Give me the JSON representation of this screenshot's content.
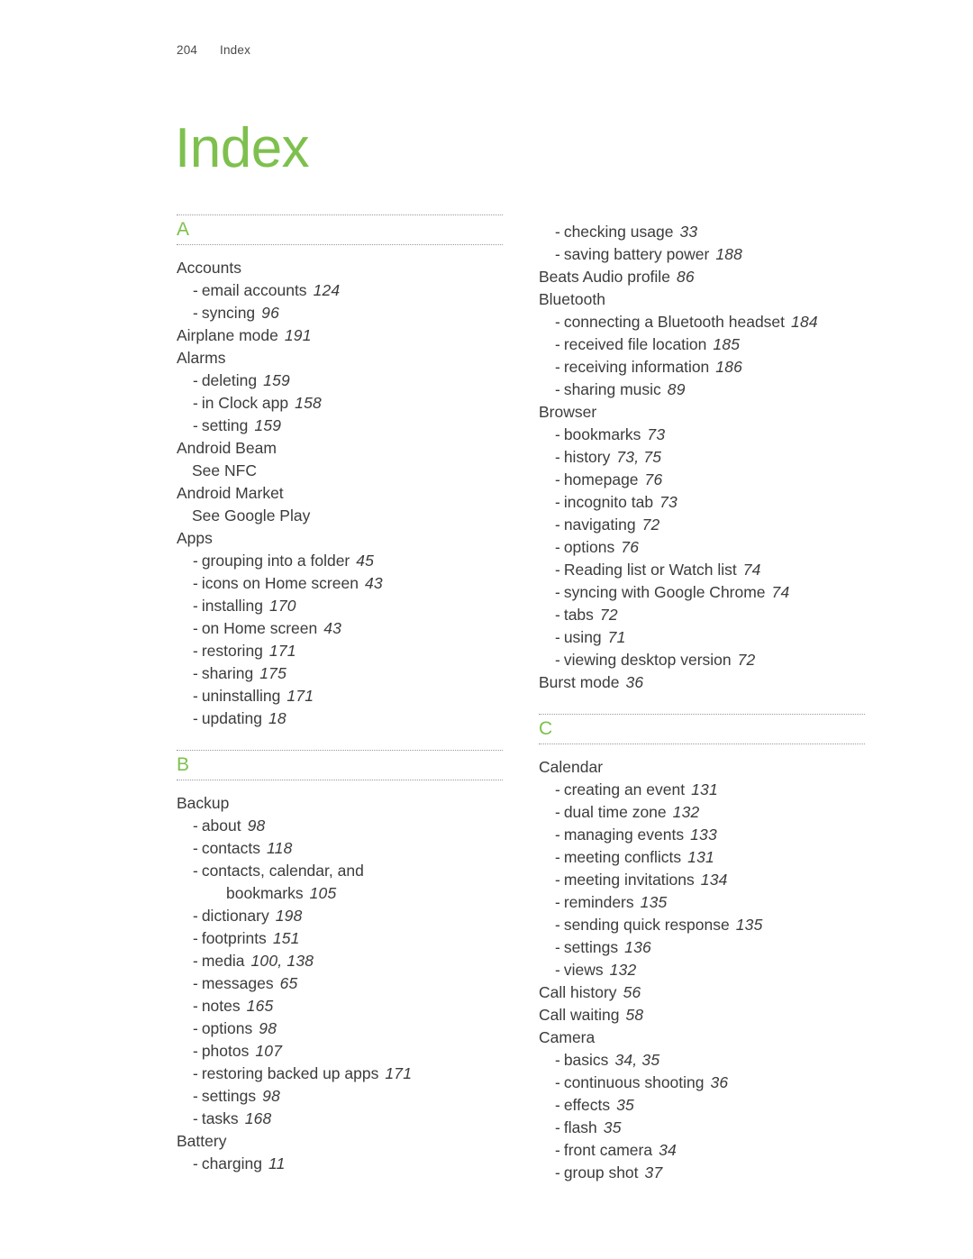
{
  "header": {
    "folio": "204",
    "section": "Index"
  },
  "title": "Index",
  "colors": {
    "accent_green": "#7ec04e",
    "body_text": "#3c3c3c",
    "rule": "#9a9a9a"
  },
  "columns": [
    {
      "name": "left-column",
      "groups": [
        {
          "letter": "A",
          "entries": [
            {
              "type": "main",
              "label": "Accounts",
              "page": ""
            },
            {
              "type": "sub",
              "label": "email accounts",
              "page": "124"
            },
            {
              "type": "sub",
              "label": "syncing",
              "page": "96"
            },
            {
              "type": "main",
              "label": "Airplane mode",
              "page": "191"
            },
            {
              "type": "main",
              "label": "Alarms",
              "page": ""
            },
            {
              "type": "sub",
              "label": "deleting",
              "page": "159"
            },
            {
              "type": "sub",
              "label": "in Clock app",
              "page": "158"
            },
            {
              "type": "sub",
              "label": "setting",
              "page": "159"
            },
            {
              "type": "main",
              "label": "Android Beam",
              "page": ""
            },
            {
              "type": "see",
              "label": "See NFC",
              "page": ""
            },
            {
              "type": "main",
              "label": "Android Market",
              "page": ""
            },
            {
              "type": "see",
              "label": "See Google Play",
              "page": ""
            },
            {
              "type": "main",
              "label": "Apps",
              "page": ""
            },
            {
              "type": "sub",
              "label": "grouping into a folder",
              "page": "45"
            },
            {
              "type": "sub",
              "label": "icons on Home screen",
              "page": "43"
            },
            {
              "type": "sub",
              "label": "installing",
              "page": "170"
            },
            {
              "type": "sub",
              "label": "on Home screen",
              "page": "43"
            },
            {
              "type": "sub",
              "label": "restoring",
              "page": "171"
            },
            {
              "type": "sub",
              "label": "sharing",
              "page": "175"
            },
            {
              "type": "sub",
              "label": "uninstalling",
              "page": "171"
            },
            {
              "type": "sub",
              "label": "updating",
              "page": "18"
            }
          ]
        },
        {
          "letter": "B",
          "entries": [
            {
              "type": "main",
              "label": "Backup",
              "page": ""
            },
            {
              "type": "sub",
              "label": "about",
              "page": "98"
            },
            {
              "type": "sub",
              "label": "contacts",
              "page": "118"
            },
            {
              "type": "sub",
              "label": "contacts, calendar, and",
              "page": ""
            },
            {
              "type": "cont",
              "label": "bookmarks",
              "page": "105"
            },
            {
              "type": "sub",
              "label": "dictionary",
              "page": "198"
            },
            {
              "type": "sub",
              "label": "footprints",
              "page": "151"
            },
            {
              "type": "sub",
              "label": "media",
              "page": "100, 138"
            },
            {
              "type": "sub",
              "label": "messages",
              "page": "65"
            },
            {
              "type": "sub",
              "label": "notes",
              "page": "165"
            },
            {
              "type": "sub",
              "label": "options",
              "page": "98"
            },
            {
              "type": "sub",
              "label": "photos",
              "page": "107"
            },
            {
              "type": "sub",
              "label": "restoring backed up apps",
              "page": "171"
            },
            {
              "type": "sub",
              "label": "settings",
              "page": "98"
            },
            {
              "type": "sub",
              "label": "tasks",
              "page": "168"
            },
            {
              "type": "main",
              "label": "Battery",
              "page": ""
            },
            {
              "type": "sub",
              "label": "charging",
              "page": "11"
            }
          ]
        }
      ]
    },
    {
      "name": "right-column",
      "groups": [
        {
          "letter": "",
          "entries": [
            {
              "type": "sub",
              "label": "checking usage",
              "page": "33"
            },
            {
              "type": "sub",
              "label": "saving battery power",
              "page": "188"
            },
            {
              "type": "main",
              "label": "Beats Audio profile",
              "page": "86"
            },
            {
              "type": "main",
              "label": "Bluetooth",
              "page": ""
            },
            {
              "type": "sub",
              "label": "connecting a Bluetooth headset",
              "page": "184"
            },
            {
              "type": "sub",
              "label": "received file location",
              "page": "185"
            },
            {
              "type": "sub",
              "label": "receiving information",
              "page": "186"
            },
            {
              "type": "sub",
              "label": "sharing music",
              "page": "89"
            },
            {
              "type": "main",
              "label": "Browser",
              "page": ""
            },
            {
              "type": "sub",
              "label": "bookmarks",
              "page": "73"
            },
            {
              "type": "sub",
              "label": "history",
              "page": "73, 75"
            },
            {
              "type": "sub",
              "label": "homepage",
              "page": "76"
            },
            {
              "type": "sub",
              "label": "incognito tab",
              "page": "73"
            },
            {
              "type": "sub",
              "label": "navigating",
              "page": "72"
            },
            {
              "type": "sub",
              "label": "options",
              "page": "76"
            },
            {
              "type": "sub",
              "label": "Reading list or Watch list",
              "page": "74"
            },
            {
              "type": "sub",
              "label": "syncing with Google Chrome",
              "page": "74"
            },
            {
              "type": "sub",
              "label": "tabs",
              "page": "72"
            },
            {
              "type": "sub",
              "label": "using",
              "page": "71"
            },
            {
              "type": "sub",
              "label": "viewing desktop version",
              "page": "72"
            },
            {
              "type": "main",
              "label": "Burst mode",
              "page": "36"
            }
          ]
        },
        {
          "letter": "C",
          "entries": [
            {
              "type": "main",
              "label": "Calendar",
              "page": ""
            },
            {
              "type": "sub",
              "label": "creating an event",
              "page": "131"
            },
            {
              "type": "sub",
              "label": "dual time zone",
              "page": "132"
            },
            {
              "type": "sub",
              "label": "managing events",
              "page": "133"
            },
            {
              "type": "sub",
              "label": "meeting conflicts",
              "page": "131"
            },
            {
              "type": "sub",
              "label": "meeting invitations",
              "page": "134"
            },
            {
              "type": "sub",
              "label": "reminders",
              "page": "135"
            },
            {
              "type": "sub",
              "label": "sending quick response",
              "page": "135"
            },
            {
              "type": "sub",
              "label": "settings",
              "page": "136"
            },
            {
              "type": "sub",
              "label": "views",
              "page": "132"
            },
            {
              "type": "main",
              "label": "Call history",
              "page": "56"
            },
            {
              "type": "main",
              "label": "Call waiting",
              "page": "58"
            },
            {
              "type": "main",
              "label": "Camera",
              "page": ""
            },
            {
              "type": "sub",
              "label": "basics",
              "page": "34, 35"
            },
            {
              "type": "sub",
              "label": "continuous shooting",
              "page": "36"
            },
            {
              "type": "sub",
              "label": "effects",
              "page": "35"
            },
            {
              "type": "sub",
              "label": "flash",
              "page": "35"
            },
            {
              "type": "sub",
              "label": "front camera",
              "page": "34"
            },
            {
              "type": "sub",
              "label": "group shot",
              "page": "37"
            }
          ]
        }
      ]
    }
  ]
}
